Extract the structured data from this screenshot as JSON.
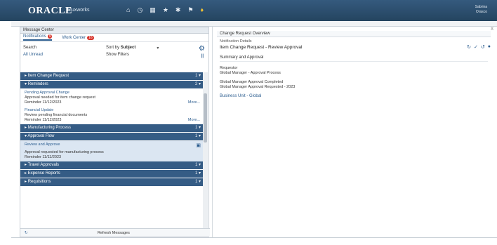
{
  "header": {
    "logo": "ORACLE",
    "app_title": "Fluxworks",
    "user_line1": "Sabrina",
    "user_line2": "Orasco"
  },
  "left": {
    "title": "Message Center",
    "tabs": [
      {
        "label": "Notifications",
        "badge": "9"
      },
      {
        "label": "Work Center",
        "badge": "16"
      }
    ],
    "filters": {
      "search_label": "Search",
      "sort_label": "Sort by",
      "sort_value": "Subject",
      "all_label": "All Unread",
      "show_label": "Show Filters"
    },
    "groups": [
      {
        "label": "Item Change Request",
        "ctl": "1 ▾",
        "items": []
      },
      {
        "label": "Reminders",
        "ctl": "2 ▾",
        "items": [
          {
            "title": "Pending Approval Change",
            "line2": "Approval needed for item change request",
            "line3": "Reminder  11/12/2023",
            "more": "More..."
          },
          {
            "title": "Financial Update",
            "line2": "Review pending financial documents",
            "line3": "Reminder  11/12/2023",
            "more": "More..."
          }
        ]
      },
      {
        "label": "Manufacturing Process",
        "ctl": "1 ▾",
        "items": []
      },
      {
        "label": "Approval Flow",
        "ctl": "1 ▾",
        "items": [
          {
            "title": "Review and Approve",
            "line2": "Approval requested for manufacturing process",
            "line3": "Reminder  11/11/2023",
            "more": ""
          }
        ]
      },
      {
        "label": "Travel Approvals",
        "ctl": "1 ▾",
        "items": []
      },
      {
        "label": "Expense Reports",
        "ctl": "1 ▾",
        "items": []
      },
      {
        "label": "Requisitions",
        "ctl": "1 ▾",
        "items": []
      }
    ],
    "footer_text": "Refresh Messages"
  },
  "right": {
    "title": "Change Request Overview",
    "close": "X",
    "sub": "Notification Details",
    "head": "Item Change Request - Review Approval",
    "section": "Summary and Approval",
    "lines_a": [
      "Requestor",
      "Global Manager - Approval Process"
    ],
    "lines_b": [
      "Global Manager Approval Completed",
      "Global Manager Approval Requested - 2023"
    ],
    "link": "Business Unit - Global"
  }
}
